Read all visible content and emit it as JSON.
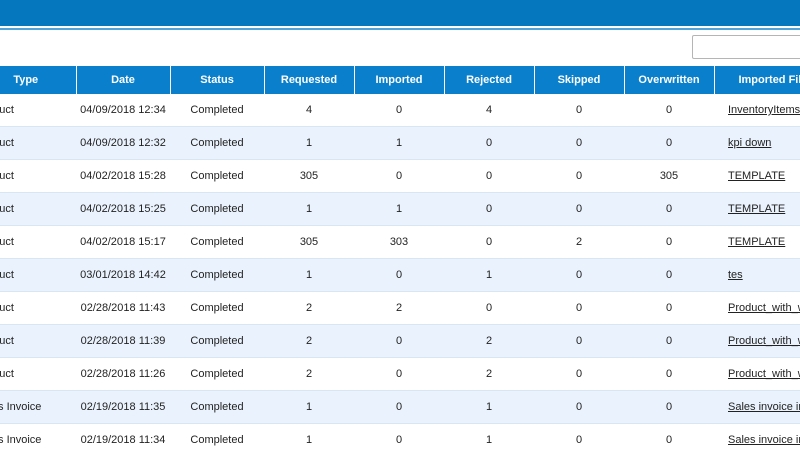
{
  "header": {
    "search_placeholder": ""
  },
  "table": {
    "columns": [
      "Type",
      "Date",
      "Status",
      "Requested",
      "Imported",
      "Rejected",
      "Skipped",
      "Overwritten",
      "Imported File"
    ],
    "rows": [
      {
        "type": "Product",
        "date": "04/09/2018 12:34",
        "status": "Completed",
        "requested": "4",
        "imported": "0",
        "rejected": "4",
        "skipped": "0",
        "overwritten": "0",
        "file": "InventoryItems_"
      },
      {
        "type": "Product",
        "date": "04/09/2018 12:32",
        "status": "Completed",
        "requested": "1",
        "imported": "1",
        "rejected": "0",
        "skipped": "0",
        "overwritten": "0",
        "file": "kpi down"
      },
      {
        "type": "Product",
        "date": "04/02/2018 15:28",
        "status": "Completed",
        "requested": "305",
        "imported": "0",
        "rejected": "0",
        "skipped": "0",
        "overwritten": "305",
        "file": "TEMPLATE"
      },
      {
        "type": "Product",
        "date": "04/02/2018 15:25",
        "status": "Completed",
        "requested": "1",
        "imported": "1",
        "rejected": "0",
        "skipped": "0",
        "overwritten": "0",
        "file": "TEMPLATE"
      },
      {
        "type": "Product",
        "date": "04/02/2018 15:17",
        "status": "Completed",
        "requested": "305",
        "imported": "303",
        "rejected": "0",
        "skipped": "2",
        "overwritten": "0",
        "file": "TEMPLATE"
      },
      {
        "type": "Product",
        "date": "03/01/2018 14:42",
        "status": "Completed",
        "requested": "1",
        "imported": "0",
        "rejected": "1",
        "skipped": "0",
        "overwritten": "0",
        "file": "tes"
      },
      {
        "type": "Product",
        "date": "02/28/2018 11:43",
        "status": "Completed",
        "requested": "2",
        "imported": "2",
        "rejected": "0",
        "skipped": "0",
        "overwritten": "0",
        "file": "Product_with_w"
      },
      {
        "type": "Product",
        "date": "02/28/2018 11:39",
        "status": "Completed",
        "requested": "2",
        "imported": "0",
        "rejected": "2",
        "skipped": "0",
        "overwritten": "0",
        "file": "Product_with_w"
      },
      {
        "type": "Product",
        "date": "02/28/2018 11:26",
        "status": "Completed",
        "requested": "2",
        "imported": "0",
        "rejected": "2",
        "skipped": "0",
        "overwritten": "0",
        "file": "Product_with_w"
      },
      {
        "type": "Sales Invoice",
        "date": "02/19/2018 11:35",
        "status": "Completed",
        "requested": "1",
        "imported": "0",
        "rejected": "1",
        "skipped": "0",
        "overwritten": "0",
        "file": "Sales invoice im"
      },
      {
        "type": "Sales Invoice",
        "date": "02/19/2018 11:34",
        "status": "Completed",
        "requested": "1",
        "imported": "0",
        "rejected": "1",
        "skipped": "0",
        "overwritten": "0",
        "file": "Sales invoice im"
      }
    ]
  }
}
